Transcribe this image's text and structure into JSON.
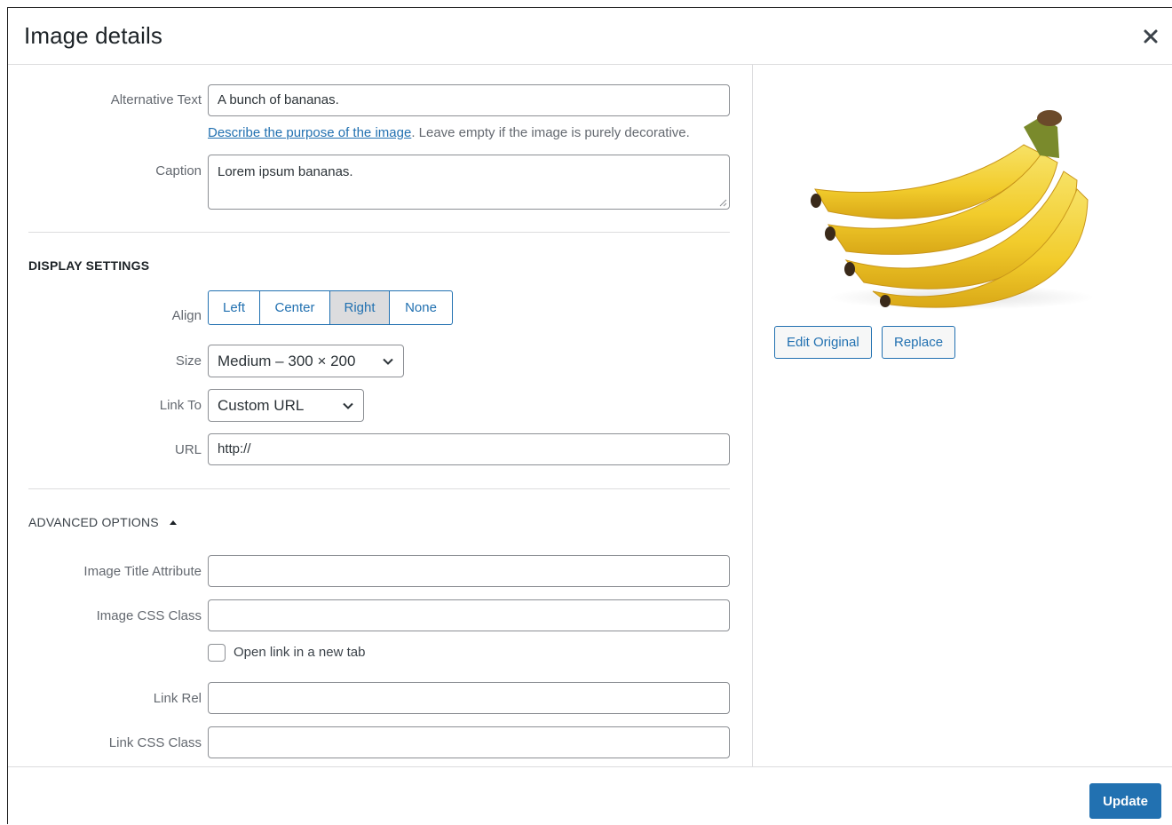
{
  "dialog": {
    "title": "Image details",
    "close_icon": "close-icon"
  },
  "form": {
    "alt_text": {
      "label": "Alternative Text",
      "value": "A bunch of bananas."
    },
    "help": {
      "link_text": "Describe the purpose of the image",
      "rest_text": ". Leave empty if the image is purely decorative."
    },
    "caption": {
      "label": "Caption",
      "value": "Lorem ipsum bananas."
    }
  },
  "display_settings": {
    "title": "Display Settings",
    "align": {
      "label": "Align",
      "options": [
        "Left",
        "Center",
        "Right",
        "None"
      ],
      "selected": "Right"
    },
    "size": {
      "label": "Size",
      "value": "Medium – 300 × 200"
    },
    "link_to": {
      "label": "Link To",
      "value": "Custom URL"
    },
    "url": {
      "label": "URL",
      "value": "http://"
    }
  },
  "advanced": {
    "title": "Advanced Options",
    "toggle_icon": "triangle-up-icon",
    "title_attribute": {
      "label": "Image Title Attribute",
      "value": ""
    },
    "css_class": {
      "label": "Image CSS Class",
      "value": ""
    },
    "new_tab": {
      "label": "Open link in a new tab",
      "checked": false
    },
    "link_rel": {
      "label": "Link Rel",
      "value": ""
    },
    "link_css_class": {
      "label": "Link CSS Class",
      "value": ""
    }
  },
  "preview": {
    "image_name": "banana-bunch-image",
    "edit_original_label": "Edit Original",
    "replace_label": "Replace"
  },
  "footer": {
    "update_label": "Update"
  },
  "colors": {
    "accent": "#2271b1",
    "border": "#dcdcde",
    "label": "#646970",
    "banana_yellow": "#f5d33c"
  }
}
